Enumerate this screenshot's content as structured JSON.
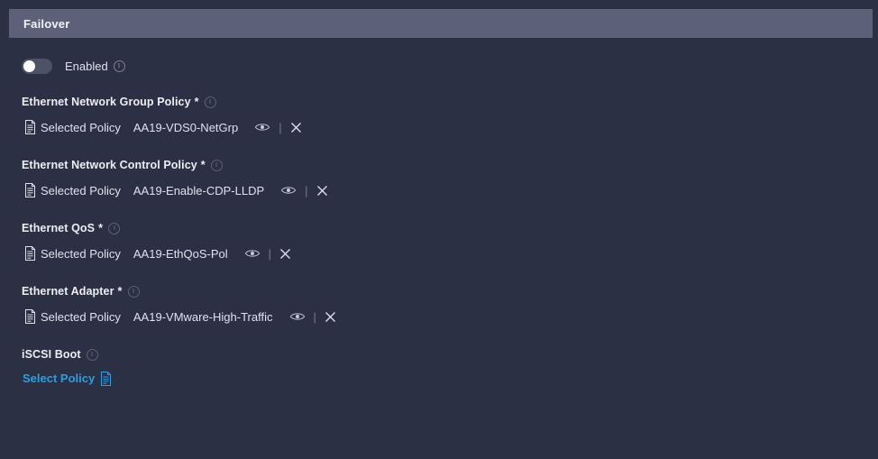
{
  "header": {
    "title": "Failover"
  },
  "toggle": {
    "label": "Enabled",
    "state": "off"
  },
  "colors": {
    "background": "#2b3044",
    "header_bar": "#5c6179",
    "link_blue": "#27a0e3",
    "text_primary": "#dfe2eb",
    "toggle_track": "#4d5367"
  },
  "fields": [
    {
      "label": "Ethernet Network Group Policy",
      "required": "*",
      "selected_tag": "Selected Policy",
      "value": "AA19-VDS0-NetGrp",
      "actions": {
        "view": "eye-icon",
        "separator": "|",
        "clear": "close-icon"
      }
    },
    {
      "label": "Ethernet Network Control Policy",
      "required": "*",
      "selected_tag": "Selected Policy",
      "value": "AA19-Enable-CDP-LLDP",
      "actions": {
        "view": "eye-icon",
        "separator": "|",
        "clear": "close-icon"
      }
    },
    {
      "label": "Ethernet QoS",
      "required": "*",
      "selected_tag": "Selected Policy",
      "value": "AA19-EthQoS-Pol",
      "actions": {
        "view": "eye-icon",
        "separator": "|",
        "clear": "close-icon"
      }
    },
    {
      "label": "Ethernet Adapter",
      "required": "*",
      "selected_tag": "Selected Policy",
      "value": "AA19-VMware-High-Traffic",
      "actions": {
        "view": "eye-icon",
        "separator": "|",
        "clear": "close-icon"
      }
    }
  ],
  "iscsi": {
    "label": "iSCSI Boot",
    "required": "",
    "select_link": "Select Policy"
  }
}
